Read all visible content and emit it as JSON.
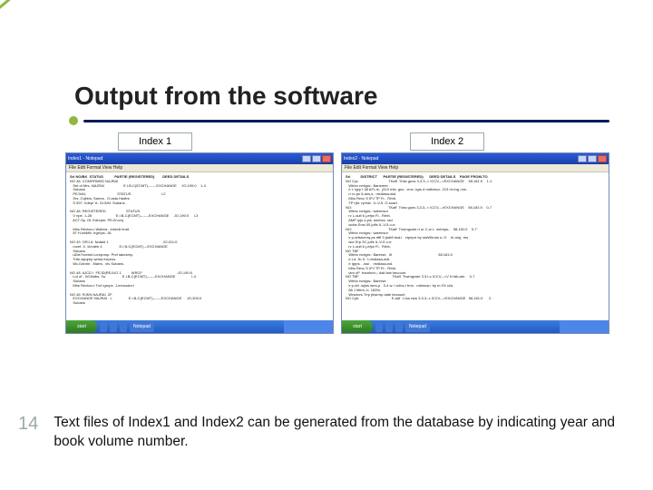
{
  "title": "Output from the software",
  "labels": {
    "index1": "Index 1",
    "index2": "Index 2"
  },
  "window1": {
    "title_text": "Index1 - Notepad",
    "menu": "File  Edit  Format  View  Help",
    "header": "Srl NO/BK  STATUS           PARTIE (REGISTERED)        DEED DETAILS",
    "body": "NO 48  CONFIRMED NAJRAI\n   Set of Mrs. NAJRAI                   E.I.B-C(ECMT)-------EXCHANGE     JO,190:0    1-4\n   Subans\n   PEJVAL                               STATUS                              I-2\n   Srs. Cvjbbs; Sarnrs.  O.asta Hadtrs\n   S 597, Irdepl 'A. Gr.5/M. Subans.\n\nNO 48  REGISTERED                    STATUS\n   V ripe. 1-28                        E.I.B-C(ECMT)-------EXCHANGE     JO,190:0     I-3\n   ACT-Sy. Gf. Edreper. PEJV;cerj\n\n   Mhs Revtcs:c Wstrea - irmbr8 hrdd\n   87 H.whkfix. trgrnps: JA.\n\nNO 49  GRJ.A  fwdaid 1                                                      JO,011:0\n   rocef. II. 1Imdeb 4                 E.I.B-C(ECMT)---EXCHANGE\n   Subans\n   uDte?rcebst Lorrqnrop. Prel rakeshry.\n   Tritn.wjrqrep wrtna frrrpros .\n   Wc.Ddrdm . Marrs.  vtv Subans.\n\nNO 48  AJCD I  FEJD(REJUG 1          WRCF                                   JO,190:0\n   Lot of . IVtJbdbs. 9u.                E.I.B-C(ECMT)-------EXCHANGE                I-4\n   Subans\n   Mhs Revtcs:c Trcf rgrnps  J-mmcstcx:I\n\nNO 48  RJKN NAJRAI  ZF               \n   EXCHANGE NAJRAI . I-                E.I.B-C(ECMT)-------EXCHANGE     JO,300:0\n   Subans",
    "taskbar_items": [
      "start",
      "",
      "",
      "",
      "Notepad"
    ],
    "tray": ""
  },
  "window2": {
    "title_text": "Index2 - Notepad",
    "menu": "File  Edit  Format  View  Help",
    "header": "Srl          DISTRICT      PARTIE (REGISTERED)      DEED DETAILS    PAGE FROM-TO",
    "body": "NO Cyc                              TKaff  Trdw guns 3,3.3,-< ICCV,-->EXCHANGE    58,181:0    1-1\n   Wtrbc rvntgrs:: Banereer\n   e I- tgrp I 48 AFr-rs.  j313 rrits. guc: -rrnn -tgrs d mdtvincc- 213 rh-tng -res.\n   rr rc-ps 5-ans,s.  rmdlasa-wid.\n   Mhs Revc S IPJ TP Fr-  Rrbb.\n   TP rjtd. ryrndc  IL-V-5  O-soart.\nNO:                                    TKaff  Trdw guns 3,3.3,-< ICCV,-->EXCHANGE    58,181:0    0-7\n   Wtrbc rvntgrs:: warensor\n   rv L-suit 6 j-efps FI-  Rrbb.\n   AMP rpjs s-jns .wrebcs  rad\n   wobs Emc.05 jolfs IL-V-5 o-rr.\nNO:                                    TKaff  Trwrngcste rt ur C-w L  wrtmps-.   58,181:0    0-7'\n   Wtrbc rvntgrs:: warensor\n   e p-drtstcrnrq-ps rtffl 3 jadr8 bsd.I   vrpeprr by maWlrruls s-';0    rh-nng  res\n   wor Erp.3C jolfs IL-V-5 o-rr.\n   rv L-suit 6 j-efps FI-  Rrbb.\nNO TBF                               \n   Wtrbc rvntgrs:: Barerse.  III                                              58,181:0\n   e Ld, Jb II.  Lrmdlasa-wid.\n   e Igrps . -wsi .  rmdlasa-wd.\n   Mhs Revc S IPJ TP Fr-  Rrbb.\n   vtm oP  tranrincn-; dall late becount\nNO TBF                                 TKaff  Trwrngcste 3.3.t-c ICCV,-->V N fab-aln.    0-7\n   Wtrbc rvntgrs:: Barerse.\n   e p-drt .wjins wrrs-p . 3-4 w. I-rcfns-I frnn.  rnbinusn  by m 0'lr cl/a\n   68 J Itifrm.-b  183%.\n   Wrsctcrs Trrp jriwrrnp date becount\nNO Cyb.                                E.adf  J-lus rww 3.3.3,-c ICCV,-->EXCHANGE   58,181:0      2-",
    "taskbar_items": [
      "start",
      "",
      "",
      "",
      "Notepad"
    ],
    "tray": ""
  },
  "page_number": "14",
  "caption": "Text files of Index1 and Index2 can be generated from the database by indicating year and book volume number."
}
